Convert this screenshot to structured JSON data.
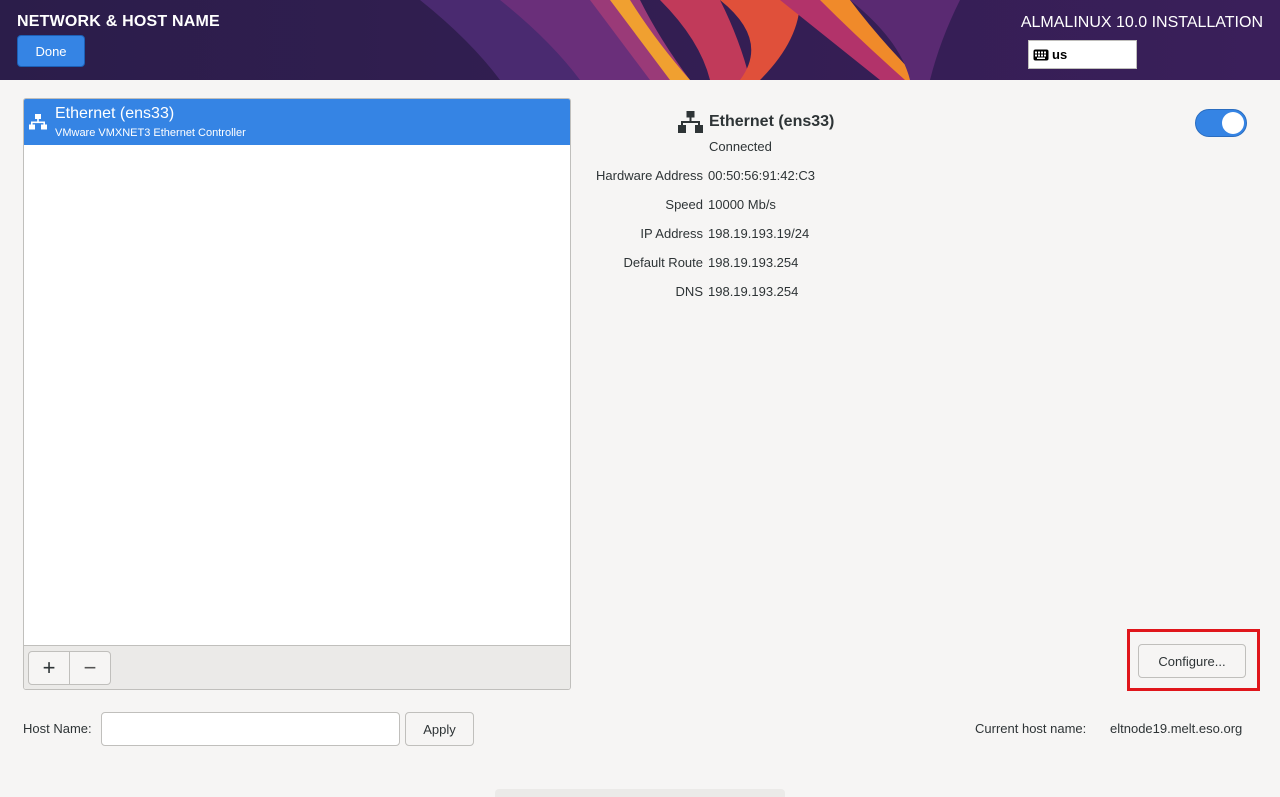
{
  "header": {
    "page_title": "NETWORK & HOST NAME",
    "done_label": "Done",
    "install_title": "ALMALINUX 10.0 INSTALLATION",
    "keyboard_layout": "us",
    "keyboard_icon": "keyboard-icon"
  },
  "device_list": {
    "items": [
      {
        "name": "Ethernet (ens33)",
        "description": "VMware VMXNET3 Ethernet Controller",
        "icon": "network-wired-icon",
        "selected": true
      }
    ],
    "add_label": "+",
    "remove_label": "−"
  },
  "details": {
    "device_name": "Ethernet (ens33)",
    "status": "Connected",
    "enabled": true,
    "rows": [
      {
        "label": "Hardware Address",
        "value": "00:50:56:91:42:C3"
      },
      {
        "label": "Speed",
        "value": "10000 Mb/s"
      },
      {
        "label": "IP Address",
        "value": "198.19.193.19/24"
      },
      {
        "label": "Default Route",
        "value": "198.19.193.254"
      },
      {
        "label": "DNS",
        "value": "198.19.193.254"
      }
    ],
    "configure_label": "Configure..."
  },
  "hostname": {
    "label": "Host Name:",
    "value": "",
    "apply_label": "Apply",
    "current_label": "Current host name:",
    "current_value": "eltnode19.melt.eso.org"
  },
  "colors": {
    "accent": "#3584e4",
    "header_bg": "#2b1d4a",
    "highlight": "#e0161b"
  }
}
